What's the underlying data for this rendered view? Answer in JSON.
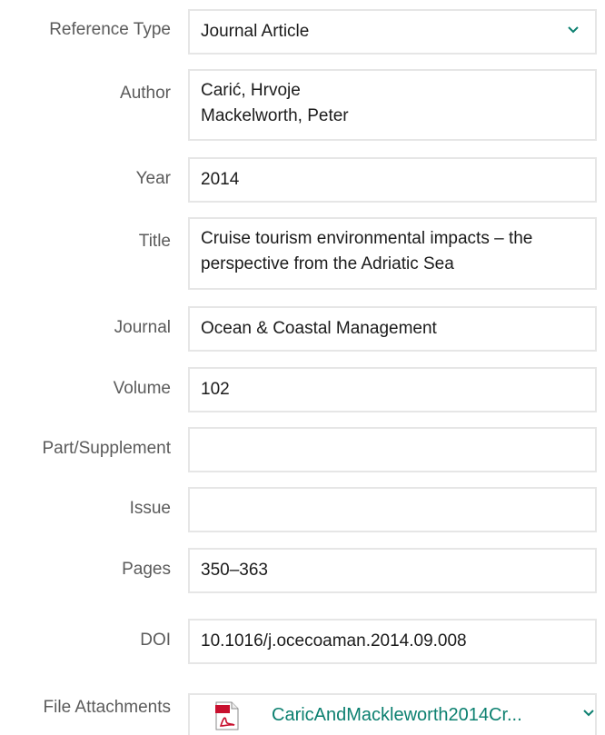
{
  "form": {
    "reference_type": {
      "label": "Reference Type",
      "value": "Journal Article"
    },
    "author": {
      "label": "Author",
      "lines": [
        "Carić, Hrvoje",
        "Mackelworth, Peter"
      ]
    },
    "year": {
      "label": "Year",
      "value": "2014"
    },
    "title": {
      "label": "Title",
      "lines": [
        "Cruise tourism environmental impacts – the",
        "perspective from the Adriatic Sea"
      ]
    },
    "journal": {
      "label": "Journal",
      "value": "Ocean & Coastal Management"
    },
    "volume": {
      "label": "Volume",
      "value": "102"
    },
    "part": {
      "label": "Part/Supplement",
      "value": ""
    },
    "issue": {
      "label": "Issue",
      "value": ""
    },
    "pages": {
      "label": "Pages",
      "value": "350–363"
    },
    "doi": {
      "label": "DOI",
      "value": "10.1016/j.ocecoaman.2014.09.008"
    },
    "attachments": {
      "label": "File Attachments",
      "file_name": "CaricAndMackleworth2014Cr...",
      "icon": "pdf-file-icon"
    }
  },
  "colors": {
    "accent": "#0c8070",
    "border": "#e6e6e6",
    "label": "#5b5b5b",
    "pdf_red": "#c8102e"
  }
}
